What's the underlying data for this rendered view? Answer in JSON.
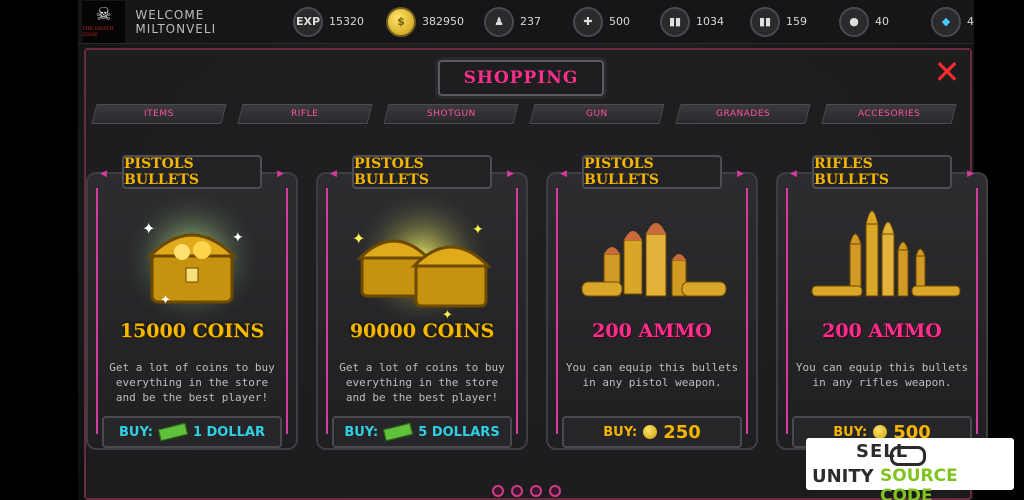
{
  "header": {
    "welcome": "WELCOME MILTONVELI",
    "stats": [
      {
        "icon": "exp-icon",
        "label": "EXP",
        "value": "15320"
      },
      {
        "icon": "coin-icon",
        "value": "382950"
      },
      {
        "icon": "zombie-icon",
        "value": "237"
      },
      {
        "icon": "medkit-icon",
        "value": "500"
      },
      {
        "icon": "pistol-ammo-icon",
        "value": "1034"
      },
      {
        "icon": "rifle-ammo-icon",
        "value": "159"
      },
      {
        "icon": "grenade-icon",
        "value": "40"
      },
      {
        "icon": "gem-icon",
        "value": "4"
      }
    ]
  },
  "shop": {
    "title": "SHOPPING",
    "tabs": [
      "ITEMS",
      "RIFLE",
      "SHOTGUN",
      "GUN",
      "GRANADES",
      "ACCESORIES"
    ],
    "cards": [
      {
        "title": "PISTOLS BULLETS",
        "amount": "15000 COINS",
        "description": "Get a lot of coins to buy everything in the store and be the best player!",
        "buy_label": "BUY:",
        "price": "1 DOLLAR"
      },
      {
        "title": "PISTOLS BULLETS",
        "amount": "90000 COINS",
        "description": "Get a lot of coins to buy everything in the store and be the best player!",
        "buy_label": "BUY:",
        "price": "5 DOLLARS"
      },
      {
        "title": "PISTOLS BULLETS",
        "amount": "200 AMMO",
        "description": "You can equip this bullets in any pistol weapon.",
        "buy_label": "BUY:",
        "price": "250"
      },
      {
        "title": "RIFLES BULLETS",
        "amount": "200 AMMO",
        "description": "You can equip this bullets in any rifles weapon.",
        "buy_label": "BUY:",
        "price": "500"
      }
    ]
  },
  "watermark": {
    "line1": "SELL",
    "line2a": "UNITY",
    "line2b": "SOURCE CODE"
  },
  "colors": {
    "accent_pink": "#ff2e8a",
    "gold": "#f4b400",
    "cyan": "#2fd0e6",
    "close_red": "#ff2a2a"
  }
}
